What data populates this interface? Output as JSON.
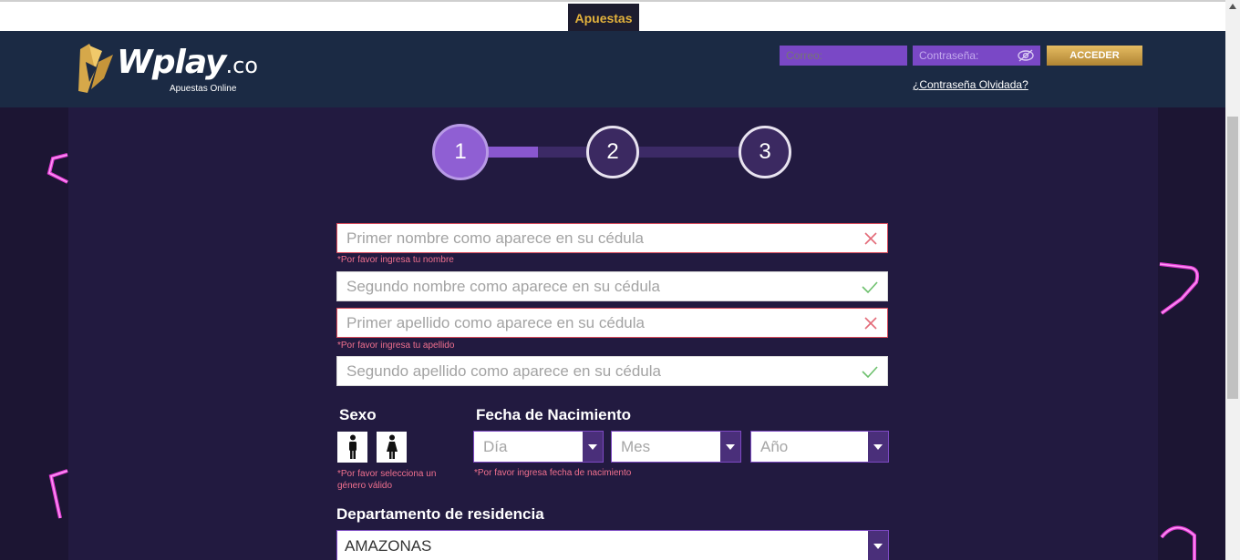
{
  "top": {
    "tab_label": "Apuestas"
  },
  "header": {
    "logo_name": "Wplay",
    "logo_ext": ".co",
    "logo_sub": "Apuestas Online",
    "email_placeholder": "Correo:",
    "password_placeholder": "Contraseña:",
    "login_button": "ACCEDER",
    "forgot_link": "¿Contraseña Olvidada?"
  },
  "stepper": {
    "steps": [
      "1",
      "2",
      "3"
    ],
    "current": 1,
    "progress_to_step2": 0.5
  },
  "form": {
    "first_name": {
      "placeholder": "Primer nombre como aparece en su cédula",
      "status": "error",
      "error": "*Por favor ingresa tu nombre"
    },
    "second_name": {
      "placeholder": "Segundo nombre como aparece en su cédula",
      "status": "valid"
    },
    "first_lastname": {
      "placeholder": "Primer apellido como aparece en su cédula",
      "status": "error",
      "error": "*Por favor ingresa tu apellido"
    },
    "second_lastname": {
      "placeholder": "Segundo apellido como aparece en su cédula",
      "status": "valid"
    },
    "sex_label": "Sexo",
    "sex_error_line1": "*Por favor selecciona un",
    "sex_error_line2": "género válido",
    "birth_label": "Fecha de Nacimiento",
    "day_placeholder": "Día",
    "month_placeholder": "Mes",
    "year_placeholder": "Año",
    "birth_error": "*Por favor ingresa fecha de nacimiento",
    "department_label": "Departamento de residencia",
    "department_value": "AMAZONAS"
  },
  "colors": {
    "accent": "#8957cf",
    "gold": "#e3b23c",
    "error": "#d94a5a",
    "valid": "#5cb85c",
    "header_bg": "#1b2a44"
  }
}
